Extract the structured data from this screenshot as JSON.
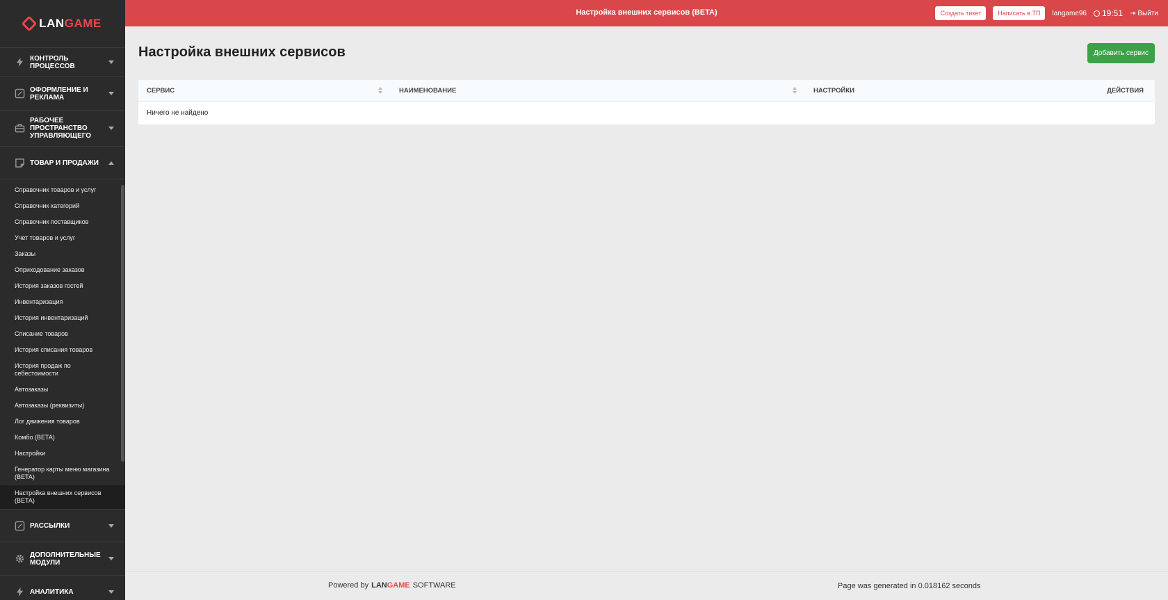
{
  "app": {
    "logo_prefix": "LAN",
    "logo_suffix": "GAME"
  },
  "header": {
    "title": "Настройка внешних сервисов (BETA)",
    "create_ticket": "Создать тикет",
    "write_support": "Написать в ТП",
    "username": "langame96",
    "time": "19:51",
    "logout": "Выйти"
  },
  "sidebar": {
    "sections": {
      "process_control": "КОНТРОЛЬ ПРОЦЕССОВ",
      "design": "ОФОРМЛЕНИЕ И РЕКЛАМА",
      "workspace": "РАБОЧЕЕ ПРОСТРАНСТВО УПРАВЛЯЮЩЕГО",
      "goods_sales": "ТОВАР И ПРОДАЖИ",
      "mailings": "РАССЫЛКИ",
      "addons": "ДОПОЛНИТЕЛЬНЫЕ МОДУЛИ",
      "analytics": "АНАЛИТИКА"
    },
    "sub_items": [
      "Справочник товаров и услуг",
      "Справочник категорий",
      "Справочник поставщиков",
      "Учет товаров и услуг",
      "Заказы",
      "Оприходование заказов",
      "История заказов гостей",
      "Инвентаризация",
      "История инвентаризаций",
      "Списание товаров",
      "История списания товаров",
      "История продаж по себестоимости",
      "Автозаказы",
      "Автозаказы (реквизиты)",
      "Лог движения товаров",
      "Комбо (BETA)",
      "Настройки",
      "Генератор карты меню магазина (BETA)",
      "Настройка внешних сервисов (BETA)"
    ]
  },
  "main": {
    "title": "Настройка внешних сервисов",
    "add_button": "Добавить сервис",
    "table": {
      "columns": [
        "СЕРВИС",
        "НАИМЕНОВАНИЕ",
        "НАСТРОЙКИ",
        "ДЕЙСТВИЯ"
      ],
      "empty_text": "Ничего не найдено"
    }
  },
  "footer": {
    "powered_by": "Powered by",
    "brand_prefix": "LAN",
    "brand_suffix": "GAME",
    "brand_software": "SOFTWARE",
    "generated": "Page was generated in 0.018162 seconds"
  },
  "colors": {
    "header_red": "#d9474b",
    "sidebar_bg": "#2b2b2b",
    "accent_green": "#3ca24a",
    "logo_red": "#e8474a"
  }
}
